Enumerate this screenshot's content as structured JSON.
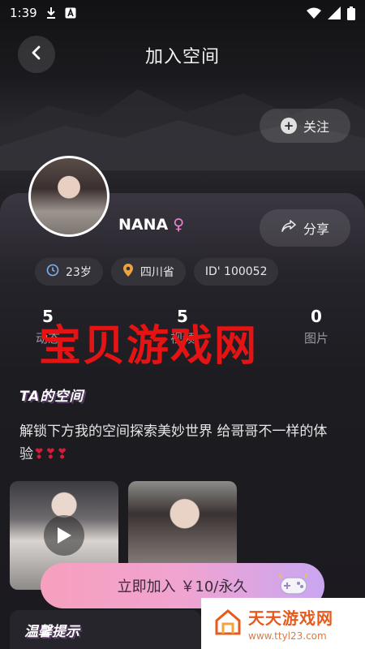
{
  "status_bar": {
    "time": "1:39",
    "icons": [
      "download-icon",
      "a-badge-icon",
      "wifi-icon",
      "signal-icon",
      "battery-icon"
    ]
  },
  "header": {
    "title": "加入空间",
    "back_icon": "chevron-left-icon"
  },
  "follow_button": {
    "label": "关注",
    "icon": "plus-circle-icon"
  },
  "profile": {
    "nickname": "NANA",
    "gender_icon": "female-icon",
    "tags": [
      {
        "icon": "clock-icon",
        "label": "23岁"
      },
      {
        "icon": "location-pin-icon",
        "label": "四川省"
      },
      {
        "icon": "id-icon",
        "label": "ID' 100052"
      }
    ]
  },
  "share_button": {
    "label": "分享",
    "icon": "share-icon"
  },
  "stats": [
    {
      "value": "5",
      "label": "动态"
    },
    {
      "value": "5",
      "label": "视频"
    },
    {
      "value": "0",
      "label": "图片"
    }
  ],
  "watermark": "宝贝游戏网",
  "space": {
    "title": "TA的空间",
    "description": "解锁下方我的空间探索美妙世界 给哥哥不一样的体验",
    "hearts": "❣❣❣"
  },
  "join_button": {
    "label": "立即加入 ￥10/永久"
  },
  "tips": {
    "title": "温馨提示"
  },
  "site_badge": {
    "name": "天天游戏网",
    "url": "www.ttyl23.com"
  },
  "colors": {
    "background": "#1a1a1f",
    "join_gradient_start": "#f79fbe",
    "join_gradient_end": "#c9a6f2",
    "watermark": "#e51414",
    "female": "#e58ac7"
  }
}
